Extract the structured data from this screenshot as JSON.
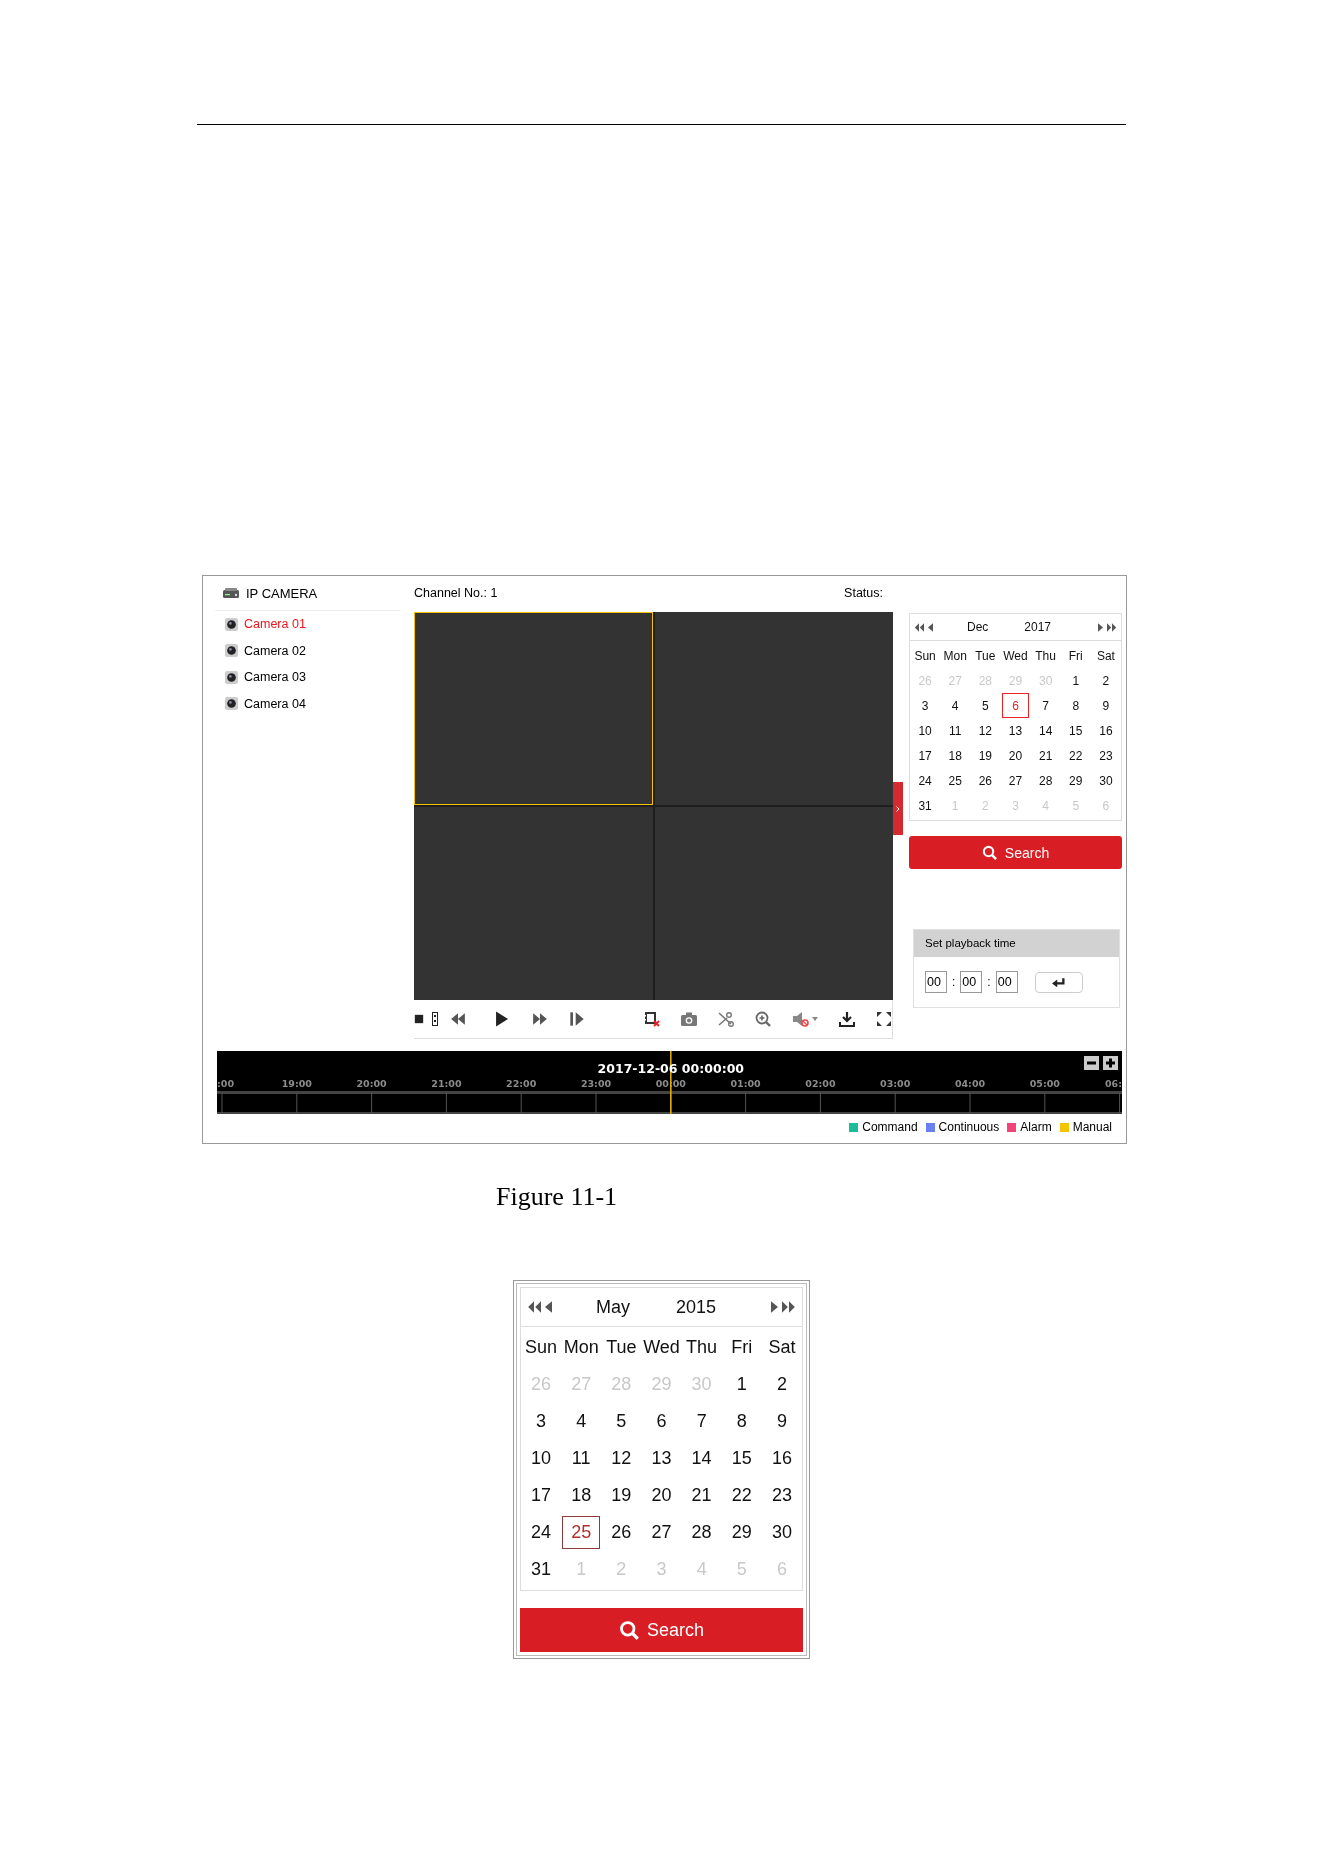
{
  "device": {
    "title": "IP CAMERA"
  },
  "cameras": [
    {
      "name": "Camera 01",
      "selected": true
    },
    {
      "name": "Camera 02",
      "selected": false
    },
    {
      "name": "Camera 03",
      "selected": false
    },
    {
      "name": "Camera 04",
      "selected": false
    }
  ],
  "channel_label": "Channel No.: 1",
  "status_label": "Status:",
  "video_windows": [
    {
      "selected": true
    },
    {
      "selected": false
    },
    {
      "selected": false
    },
    {
      "selected": false
    }
  ],
  "calendar": {
    "month": "Dec",
    "year": "2017",
    "search_button": "Search",
    "weekdays": [
      "Sun",
      "Mon",
      "Tue",
      "Wed",
      "Thu",
      "Fri",
      "Sat"
    ],
    "days": [
      {
        "day": "26",
        "in_month": false,
        "selected": false
      },
      {
        "day": "27",
        "in_month": false,
        "selected": false
      },
      {
        "day": "28",
        "in_month": false,
        "selected": false
      },
      {
        "day": "29",
        "in_month": false,
        "selected": false
      },
      {
        "day": "30",
        "in_month": false,
        "selected": false
      },
      {
        "day": "1",
        "in_month": true,
        "selected": false
      },
      {
        "day": "2",
        "in_month": true,
        "selected": false
      },
      {
        "day": "3",
        "in_month": true,
        "selected": false
      },
      {
        "day": "4",
        "in_month": true,
        "selected": false
      },
      {
        "day": "5",
        "in_month": true,
        "selected": false
      },
      {
        "day": "6",
        "in_month": true,
        "selected": true
      },
      {
        "day": "7",
        "in_month": true,
        "selected": false
      },
      {
        "day": "8",
        "in_month": true,
        "selected": false
      },
      {
        "day": "9",
        "in_month": true,
        "selected": false
      },
      {
        "day": "10",
        "in_month": true,
        "selected": false
      },
      {
        "day": "11",
        "in_month": true,
        "selected": false
      },
      {
        "day": "12",
        "in_month": true,
        "selected": false
      },
      {
        "day": "13",
        "in_month": true,
        "selected": false
      },
      {
        "day": "14",
        "in_month": true,
        "selected": false
      },
      {
        "day": "15",
        "in_month": true,
        "selected": false
      },
      {
        "day": "16",
        "in_month": true,
        "selected": false
      },
      {
        "day": "17",
        "in_month": true,
        "selected": false
      },
      {
        "day": "18",
        "in_month": true,
        "selected": false
      },
      {
        "day": "19",
        "in_month": true,
        "selected": false
      },
      {
        "day": "20",
        "in_month": true,
        "selected": false
      },
      {
        "day": "21",
        "in_month": true,
        "selected": false
      },
      {
        "day": "22",
        "in_month": true,
        "selected": false
      },
      {
        "day": "23",
        "in_month": true,
        "selected": false
      },
      {
        "day": "24",
        "in_month": true,
        "selected": false
      },
      {
        "day": "25",
        "in_month": true,
        "selected": false
      },
      {
        "day": "26",
        "in_month": true,
        "selected": false
      },
      {
        "day": "27",
        "in_month": true,
        "selected": false
      },
      {
        "day": "28",
        "in_month": true,
        "selected": false
      },
      {
        "day": "29",
        "in_month": true,
        "selected": false
      },
      {
        "day": "30",
        "in_month": true,
        "selected": false
      },
      {
        "day": "31",
        "in_month": true,
        "selected": false
      },
      {
        "day": "1",
        "in_month": false,
        "selected": false
      },
      {
        "day": "2",
        "in_month": false,
        "selected": false
      },
      {
        "day": "3",
        "in_month": false,
        "selected": false
      },
      {
        "day": "4",
        "in_month": false,
        "selected": false
      },
      {
        "day": "5",
        "in_month": false,
        "selected": false
      },
      {
        "day": "6",
        "in_month": false,
        "selected": false
      }
    ]
  },
  "playback_time": {
    "title": "Set playback time",
    "fields": [
      "00",
      "00",
      "00"
    ],
    "separators": [
      ":",
      ":"
    ]
  },
  "timeline": {
    "timestamp": "2017-12-06 00:00:00",
    "hours": [
      ":00",
      "19:00",
      "20:00",
      "21:00",
      "22:00",
      "23:00",
      "00:00",
      "01:00",
      "02:00",
      "03:00",
      "04:00",
      "05:00",
      "06:"
    ]
  },
  "legend": [
    {
      "label": "Command",
      "color": "#1abc9c"
    },
    {
      "label": "Continuous",
      "color": "#6a7ff0"
    },
    {
      "label": "Alarm",
      "color": "#f0457a"
    },
    {
      "label": "Manual",
      "color": "#f5c400"
    }
  ],
  "figure_caption": "Figure 11-1",
  "calendar_2": {
    "month": "May",
    "year": "2015",
    "search_button": "Search",
    "weekdays": [
      "Sun",
      "Mon",
      "Tue",
      "Wed",
      "Thu",
      "Fri",
      "Sat"
    ],
    "days": [
      {
        "day": "26",
        "in_month": false,
        "selected": false
      },
      {
        "day": "27",
        "in_month": false,
        "selected": false
      },
      {
        "day": "28",
        "in_month": false,
        "selected": false
      },
      {
        "day": "29",
        "in_month": false,
        "selected": false
      },
      {
        "day": "30",
        "in_month": false,
        "selected": false
      },
      {
        "day": "1",
        "in_month": true,
        "selected": false
      },
      {
        "day": "2",
        "in_month": true,
        "selected": false
      },
      {
        "day": "3",
        "in_month": true,
        "selected": false
      },
      {
        "day": "4",
        "in_month": true,
        "selected": false
      },
      {
        "day": "5",
        "in_month": true,
        "selected": false
      },
      {
        "day": "6",
        "in_month": true,
        "selected": false
      },
      {
        "day": "7",
        "in_month": true,
        "selected": false
      },
      {
        "day": "8",
        "in_month": true,
        "selected": false
      },
      {
        "day": "9",
        "in_month": true,
        "selected": false
      },
      {
        "day": "10",
        "in_month": true,
        "selected": false
      },
      {
        "day": "11",
        "in_month": true,
        "selected": false
      },
      {
        "day": "12",
        "in_month": true,
        "selected": false
      },
      {
        "day": "13",
        "in_month": true,
        "selected": false
      },
      {
        "day": "14",
        "in_month": true,
        "selected": false
      },
      {
        "day": "15",
        "in_month": true,
        "selected": false
      },
      {
        "day": "16",
        "in_month": true,
        "selected": false
      },
      {
        "day": "17",
        "in_month": true,
        "selected": false
      },
      {
        "day": "18",
        "in_month": true,
        "selected": false
      },
      {
        "day": "19",
        "in_month": true,
        "selected": false
      },
      {
        "day": "20",
        "in_month": true,
        "selected": false
      },
      {
        "day": "21",
        "in_month": true,
        "selected": false
      },
      {
        "day": "22",
        "in_month": true,
        "selected": false
      },
      {
        "day": "23",
        "in_month": true,
        "selected": false
      },
      {
        "day": "24",
        "in_month": true,
        "selected": false
      },
      {
        "day": "25",
        "in_month": true,
        "selected": true
      },
      {
        "day": "26",
        "in_month": true,
        "selected": false
      },
      {
        "day": "27",
        "in_month": true,
        "selected": false
      },
      {
        "day": "28",
        "in_month": true,
        "selected": false
      },
      {
        "day": "29",
        "in_month": true,
        "selected": false
      },
      {
        "day": "30",
        "in_month": true,
        "selected": false
      },
      {
        "day": "31",
        "in_month": true,
        "selected": false
      },
      {
        "day": "1",
        "in_month": false,
        "selected": false
      },
      {
        "day": "2",
        "in_month": false,
        "selected": false
      },
      {
        "day": "3",
        "in_month": false,
        "selected": false
      },
      {
        "day": "4",
        "in_month": false,
        "selected": false
      },
      {
        "day": "5",
        "in_month": false,
        "selected": false
      },
      {
        "day": "6",
        "in_month": false,
        "selected": false
      }
    ]
  }
}
